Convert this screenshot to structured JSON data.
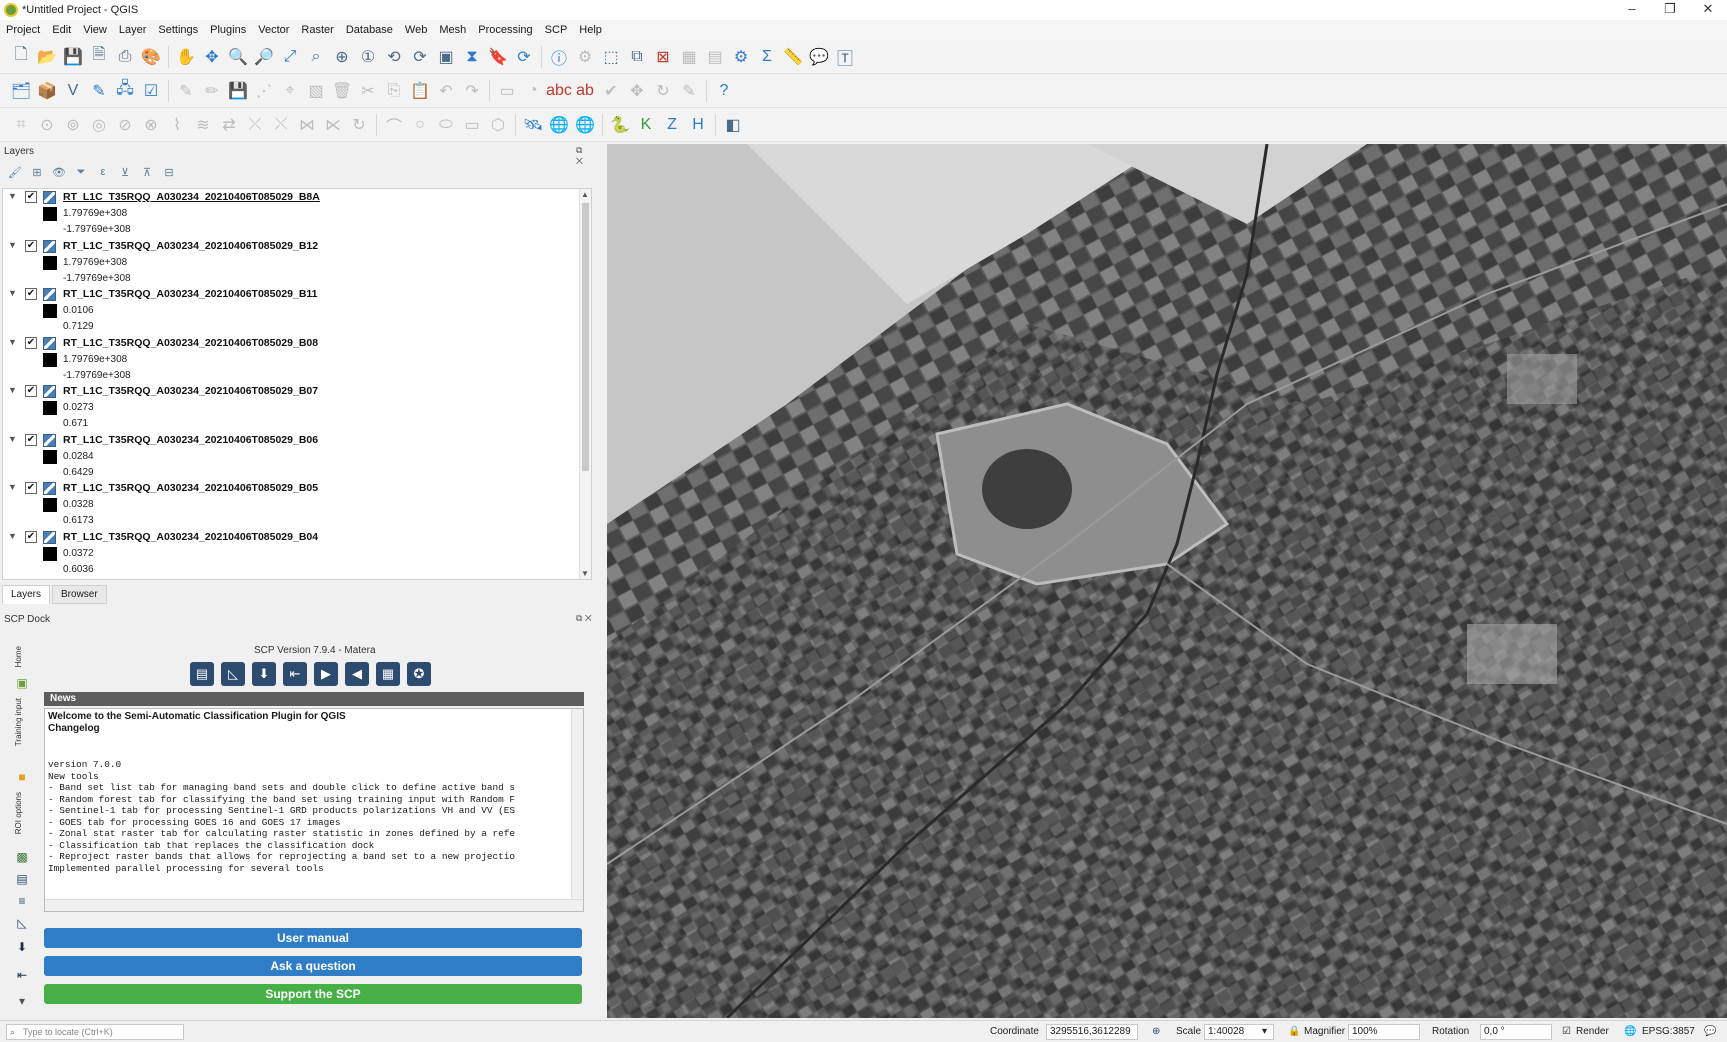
{
  "window": {
    "title": "*Untitled Project - QGIS",
    "min": "–",
    "restore": "❐",
    "close": "✕"
  },
  "menu": [
    "Project",
    "Edit",
    "View",
    "Layer",
    "Settings",
    "Plugins",
    "Vector",
    "Raster",
    "Database",
    "Web",
    "Mesh",
    "Processing",
    "SCP",
    "Help"
  ],
  "layers_panel": {
    "title": "Layers",
    "layers": [
      {
        "name": "RT_L1C_T35RQQ_A030234_20210406T085029_B8A",
        "max": "1.79769e+308",
        "min": "-1.79769e+308"
      },
      {
        "name": "RT_L1C_T35RQQ_A030234_20210406T085029_B12",
        "max": "1.79769e+308",
        "min": "-1.79769e+308"
      },
      {
        "name": "RT_L1C_T35RQQ_A030234_20210406T085029_B11",
        "max": "0.0106",
        "min": "0.7129"
      },
      {
        "name": "RT_L1C_T35RQQ_A030234_20210406T085029_B08",
        "max": "1.79769e+308",
        "min": "-1.79769e+308"
      },
      {
        "name": "RT_L1C_T35RQQ_A030234_20210406T085029_B07",
        "max": "0.0273",
        "min": "0.671"
      },
      {
        "name": "RT_L1C_T35RQQ_A030234_20210406T085029_B06",
        "max": "0.0284",
        "min": "0.6429"
      },
      {
        "name": "RT_L1C_T35RQQ_A030234_20210406T085029_B05",
        "max": "0.0328",
        "min": "0.6173"
      },
      {
        "name": "RT_L1C_T35RQQ_A030234_20210406T085029_B04",
        "max": "0.0372",
        "min": "0.6036"
      }
    ],
    "tabs": [
      "Layers",
      "Browser"
    ]
  },
  "scp_dock": {
    "title": "SCP Dock",
    "side_tabs": [
      "Home",
      "Training input",
      "ROI options"
    ],
    "version": "SCP Version 7.9.4 - Matera",
    "news_header": "News",
    "news_title_1": "Welcome to the Semi-Automatic Classification Plugin for QGIS",
    "news_title_2": "Changelog",
    "news_lines": [
      "version 7.0.0",
      "New tools",
      "- Band set list tab for managing band sets and double click to define active band s",
      "- Random forest tab for classifying the band set using training input with Random F",
      "- Sentinel-1 tab for processing Sentinel-1 GRD products polarizations VH and VV (ES",
      "- GOES tab for processing GOES 16 and GOES 17 images",
      "- Zonal stat raster tab for calculating raster statistic in zones defined by a refe",
      "- Classification tab that replaces the classification dock",
      "- Reproject raster bands that allows for reprojecting a band set to a new projectio",
      "",
      "Implemented parallel processing for several tools"
    ],
    "btn_manual": "User manual",
    "btn_question": "Ask a question",
    "btn_support": "Support the SCP"
  },
  "status": {
    "locate_placeholder": "Type to locate (Ctrl+K)",
    "coordinate_label": "Coordinate",
    "coordinate_value": "3295516,3612289",
    "scale_label": "Scale",
    "scale_value": "1:40028",
    "magnifier_label": "Magnifier",
    "magnifier_value": "100%",
    "rotation_label": "Rotation",
    "rotation_value": "0,0 °",
    "render_label": "Render",
    "crs": "EPSG:3857"
  }
}
